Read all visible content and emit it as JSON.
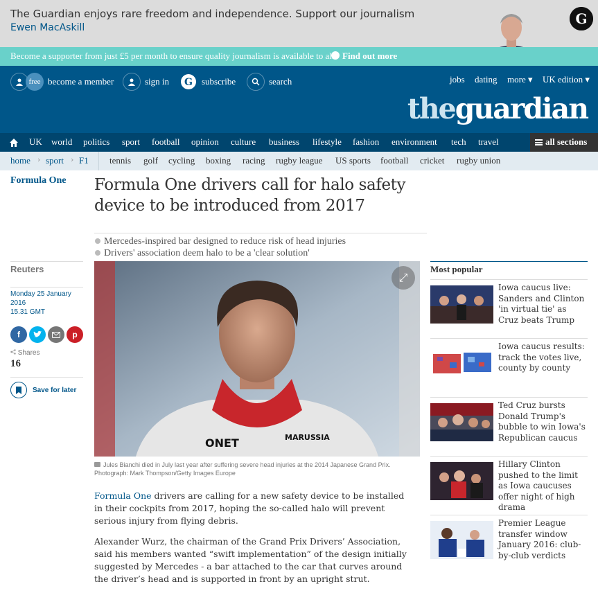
{
  "ad": {
    "text": "The Guardian enjoys rare freedom and independence. Support our journalism",
    "author": "Ewen MacAskill"
  },
  "supporter": {
    "text": "Become a supporter from just £5 per month to ensure quality journalism is available to all.",
    "cta": "Find out more"
  },
  "header": {
    "free": "free",
    "become_member": "become a member",
    "sign_in": "sign in",
    "subscribe": "subscribe",
    "search": "search",
    "jobs": "jobs",
    "dating": "dating",
    "more": "more ▾",
    "edition": "UK edition ▾",
    "logo_the": "the",
    "logo_guardian": "guardian"
  },
  "secnav": {
    "items": [
      "UK",
      "world",
      "politics",
      "sport",
      "football",
      "opinion",
      "culture",
      "business",
      "lifestyle",
      "fashion",
      "environment",
      "tech",
      "travel"
    ],
    "all_sections": "all sections"
  },
  "subnav": {
    "breadcrumbs": [
      "home",
      "sport",
      "F1"
    ],
    "items": [
      "tennis",
      "golf",
      "cycling",
      "boxing",
      "racing",
      "rugby league",
      "US sports",
      "football",
      "cricket",
      "rugby union"
    ]
  },
  "article": {
    "section": "Formula One",
    "headline": "Formula One drivers call for halo safety device to be introduced from 2017",
    "standfirst": [
      "Mercedes-inspired bar designed to reduce risk of head injuries",
      "Drivers' association deem halo to be a 'clear solution'"
    ],
    "byline": "Reuters",
    "date_line1": "Monday 25 January 2016",
    "date_line2": "15.31 GMT",
    "shares_label": "Shares",
    "shares_count": "16",
    "save_label": "Save for later",
    "caption": "Jules Bianchi died in July last year after suffering severe head injuries at the 2014 Japanese Grand Prix. Photograph: Mark Thompson/Getty Images Europe",
    "para1_link": "Formula One",
    "para1_rest": " drivers are calling for a new safety device to be installed in their cockpits from 2017, hoping the so-called halo will prevent serious injury from flying debris.",
    "para2": "Alexander Wurz, the chairman of the Grand Prix Drivers’ Association, said his members wanted “swift implementation” of the design initially suggested by Mercedes - a bar attached to the car that curves around the driver’s head and is supported in front by an upright strut."
  },
  "most_popular": {
    "title": "Most popular",
    "items": [
      "Iowa caucus live: Sanders and Clinton 'in virtual tie' as Cruz beats Trump",
      "Iowa caucus results: track the votes live, county by county",
      "Ted Cruz bursts Donald Trump's bubble to win Iowa's Republican caucus",
      "Hillary Clinton pushed to the limit as Iowa caucuses offer night of high drama",
      "Premier League transfer window January 2016: club-by-club verdicts"
    ]
  },
  "colors": {
    "brand_blue": "#005689",
    "nav_dark": "#00456e",
    "supporter_teal": "#69d1ca"
  }
}
